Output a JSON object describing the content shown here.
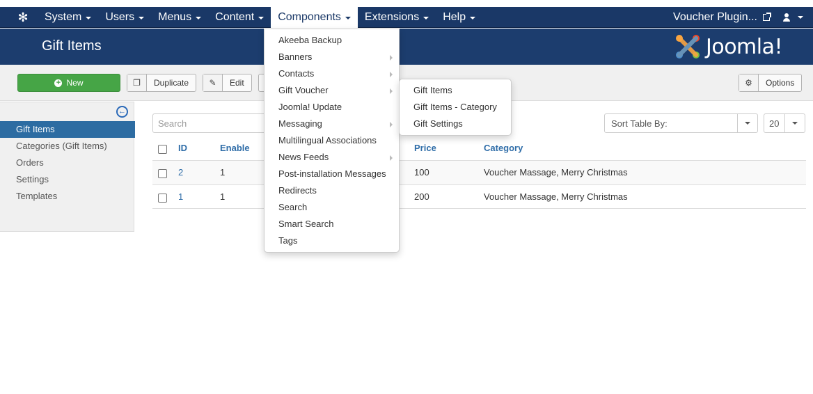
{
  "navbar": {
    "menu": [
      {
        "label": "System"
      },
      {
        "label": "Users"
      },
      {
        "label": "Menus"
      },
      {
        "label": "Content"
      },
      {
        "label": "Components"
      },
      {
        "label": "Extensions"
      },
      {
        "label": "Help"
      }
    ],
    "site_link": "Voucher Plugin..."
  },
  "header": {
    "title": "Gift Items",
    "logo_text": "Joomla!"
  },
  "toolbar": {
    "new_label": "New",
    "duplicate_label": "Duplicate",
    "edit_label": "Edit",
    "options_label": "Options"
  },
  "sidebar": {
    "items": [
      {
        "label": "Gift Items"
      },
      {
        "label": "Categories (Gift Items)"
      },
      {
        "label": "Orders"
      },
      {
        "label": "Settings"
      },
      {
        "label": "Templates"
      }
    ]
  },
  "filters": {
    "search_placeholder": "Search",
    "sort_label": "Sort Table By:",
    "limit_value": "20"
  },
  "table": {
    "columns": {
      "id": "ID",
      "enable": "Enable",
      "price": "Price",
      "category": "Category"
    },
    "rows": [
      {
        "id": "2",
        "enable": "1",
        "price": "100",
        "category": "Voucher Massage, Merry Christmas"
      },
      {
        "id": "1",
        "enable": "1",
        "price": "200",
        "category": "Voucher Massage, Merry Christmas"
      }
    ]
  },
  "components_menu": {
    "items": [
      {
        "label": "Akeeba Backup"
      },
      {
        "label": "Banners"
      },
      {
        "label": "Contacts"
      },
      {
        "label": "Gift Voucher"
      },
      {
        "label": "Joomla! Update"
      },
      {
        "label": "Messaging"
      },
      {
        "label": "Multilingual Associations"
      },
      {
        "label": "News Feeds"
      },
      {
        "label": "Post-installation Messages"
      },
      {
        "label": "Redirects"
      },
      {
        "label": "Search"
      },
      {
        "label": "Smart Search"
      },
      {
        "label": "Tags"
      }
    ]
  },
  "gift_voucher_submenu": {
    "items": [
      {
        "label": "Gift Items"
      },
      {
        "label": "Gift Items - Category"
      },
      {
        "label": "Gift Settings"
      }
    ]
  },
  "colors": {
    "navbar": "#1a3867",
    "header": "#1c3d6e",
    "new_button": "#46a546",
    "sidebar_active": "#2d6ca2",
    "link": "#2f6da8"
  }
}
